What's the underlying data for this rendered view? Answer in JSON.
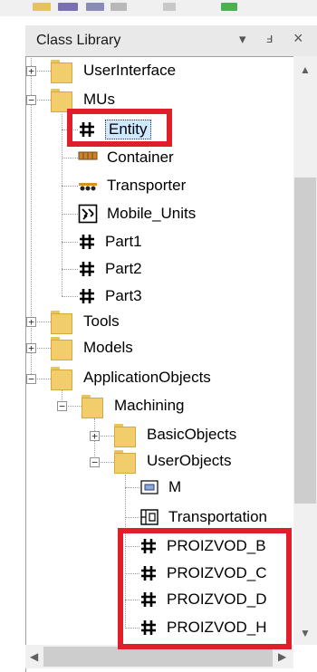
{
  "panel": {
    "title": "Class Library",
    "dropdown_glyph": "▾",
    "pin_glyph": "ⅎ",
    "close_glyph": "×"
  },
  "tree": {
    "user_interface": "UserInterface",
    "mus": "MUs",
    "entity": "Entity",
    "container": "Container",
    "transporter": "Transporter",
    "mobile_units": "Mobile_Units",
    "part1": "Part1",
    "part2": "Part2",
    "part3": "Part3",
    "tools": "Tools",
    "models": "Models",
    "application_objects": "ApplicationObjects",
    "machining": "Machining",
    "basic_objects": "BasicObjects",
    "user_objects": "UserObjects",
    "m": "M",
    "transportation": "Transportation",
    "proizvod_b": "PROIZVOD_B",
    "proizvod_c": "PROIZVOD_C",
    "proizvod_d": "PROIZVOD_D",
    "proizvod_h": "PROIZVOD_H"
  },
  "expanders": {
    "plus": "+",
    "minus": "−"
  },
  "colors": {
    "highlight": "#e01f2a",
    "folder": "#f2cd6b",
    "selection": "#cde8ff"
  },
  "icons": {
    "class": "hash-grid-icon",
    "container": "container-icon",
    "transporter": "transporter-icon",
    "mobile_units": "mobile-units-icon",
    "m": "method-icon",
    "transportation": "frame-icon"
  }
}
